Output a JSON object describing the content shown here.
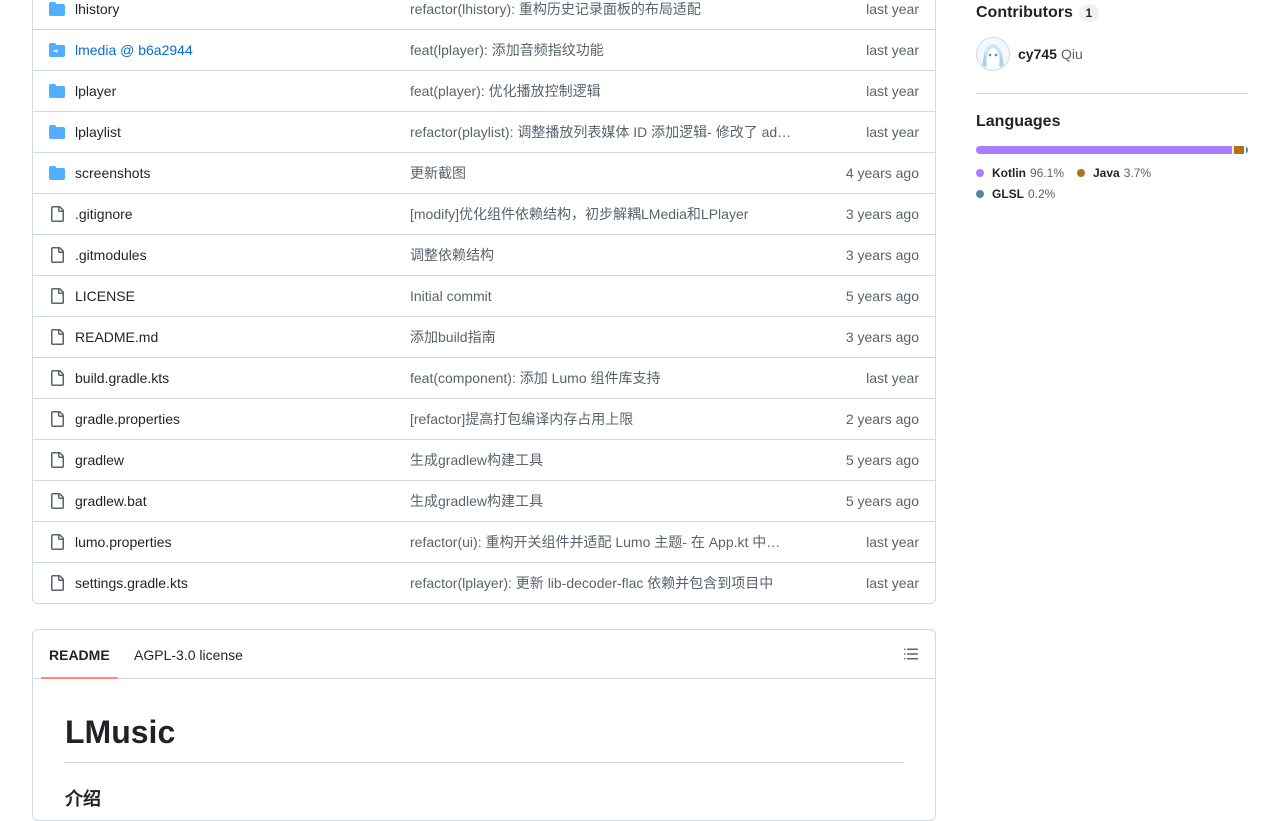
{
  "files": [
    {
      "icon": "folder-icon",
      "name": "lhistory",
      "message": "refactor(lhistory): 重构历史记录面板的布局适配",
      "date": "last year"
    },
    {
      "icon": "submodule-icon",
      "name": "lmedia @ b6a2944",
      "message": "feat(lplayer): 添加音频指纹功能",
      "date": "last year"
    },
    {
      "icon": "folder-icon",
      "name": "lplayer",
      "message": "feat(player): 优化播放控制逻辑",
      "date": "last year"
    },
    {
      "icon": "folder-icon",
      "name": "lplaylist",
      "message": "refactor(playlist): 调整播放列表媒体 ID 添加逻辑- 修改了 ad…",
      "date": "last year"
    },
    {
      "icon": "folder-icon",
      "name": "screenshots",
      "message": "更新截图",
      "date": "4 years ago"
    },
    {
      "icon": "file-icon",
      "name": ".gitignore",
      "message": "[modify]优化组件依赖结构，初步解耦LMedia和LPlayer",
      "date": "3 years ago"
    },
    {
      "icon": "file-icon",
      "name": ".gitmodules",
      "message": "调整依赖结构",
      "date": "3 years ago"
    },
    {
      "icon": "file-icon",
      "name": "LICENSE",
      "message": "Initial commit",
      "date": "5 years ago"
    },
    {
      "icon": "file-icon",
      "name": "README.md",
      "message": "添加build指南",
      "date": "3 years ago"
    },
    {
      "icon": "file-icon",
      "name": "build.gradle.kts",
      "message": "feat(component): 添加 Lumo 组件库支持",
      "date": "last year"
    },
    {
      "icon": "file-icon",
      "name": "gradle.properties",
      "message": "[refactor]提高打包编译内存占用上限",
      "date": "2 years ago"
    },
    {
      "icon": "file-icon",
      "name": "gradlew",
      "message": "生成gradlew构建工具",
      "date": "5 years ago"
    },
    {
      "icon": "file-icon",
      "name": "gradlew.bat",
      "message": "生成gradlew构建工具",
      "date": "5 years ago"
    },
    {
      "icon": "file-icon",
      "name": "lumo.properties",
      "message": "refactor(ui): 重构开关组件并适配 Lumo 主题- 在 App.kt 中…",
      "date": "last year"
    },
    {
      "icon": "file-icon",
      "name": "settings.gradle.kts",
      "message": "refactor(lplayer): 更新 lib-decoder-flac 依赖并包含到项目中",
      "date": "last year"
    }
  ],
  "readme": {
    "tab_readme": "README",
    "tab_license": "AGPL-3.0 license",
    "outline_icon": "list-unordered-icon",
    "title": "LMusic",
    "subtitle": "介绍"
  },
  "sidebar": {
    "contributors": {
      "title": "Contributors",
      "count": "1",
      "list": [
        {
          "login": "cy745",
          "name": "Qiu"
        }
      ]
    },
    "languages": {
      "title": "Languages",
      "list": [
        {
          "name": "Kotlin",
          "percent": "96.1%",
          "value": 96.1,
          "color": "#A97BFF"
        },
        {
          "name": "Java",
          "percent": "3.7%",
          "value": 3.7,
          "color": "#b07219"
        },
        {
          "name": "GLSL",
          "percent": "0.2%",
          "value": 0.2,
          "color": "#5686a5"
        }
      ]
    }
  },
  "colors": {
    "link": "#0969da",
    "folder": "#54aeff",
    "muted": "#59636e",
    "border": "#d1d9e0",
    "tab_underline": "#fd8c73"
  }
}
